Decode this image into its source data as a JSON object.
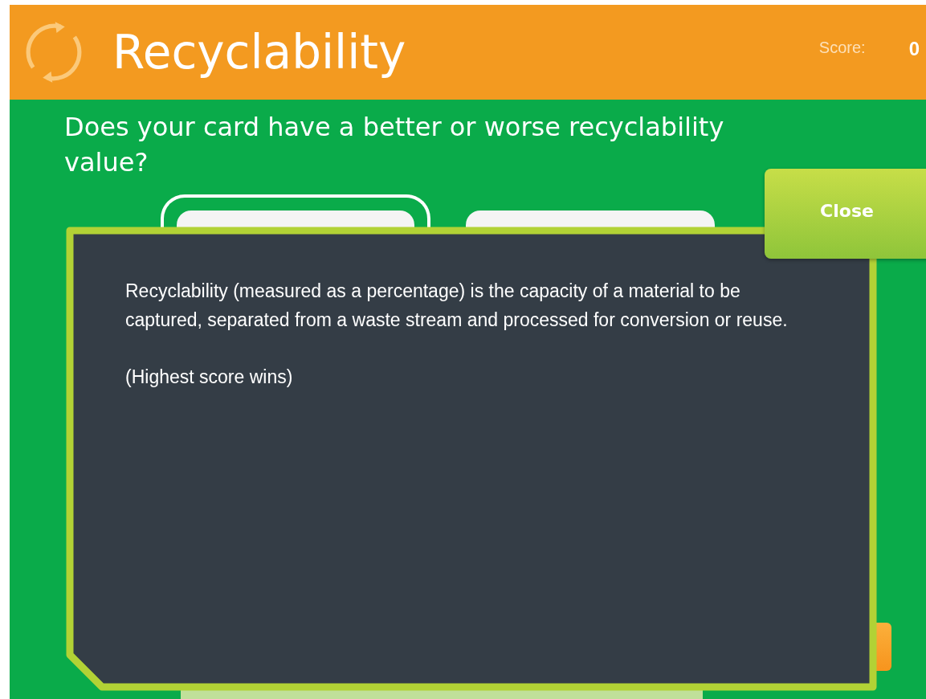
{
  "header": {
    "title": "Recyclability",
    "score_label": "Score:",
    "score_value": "0"
  },
  "question": "Does your card have a better or worse recyclability value?",
  "dialog": {
    "paragraphs": [
      "Recyclability (measured as a percentage) is the capacity of a material to be captured, separated from a waste stream and processed for conversion or reuse.",
      "(Highest score wins)"
    ],
    "close_button": "Close"
  }
}
